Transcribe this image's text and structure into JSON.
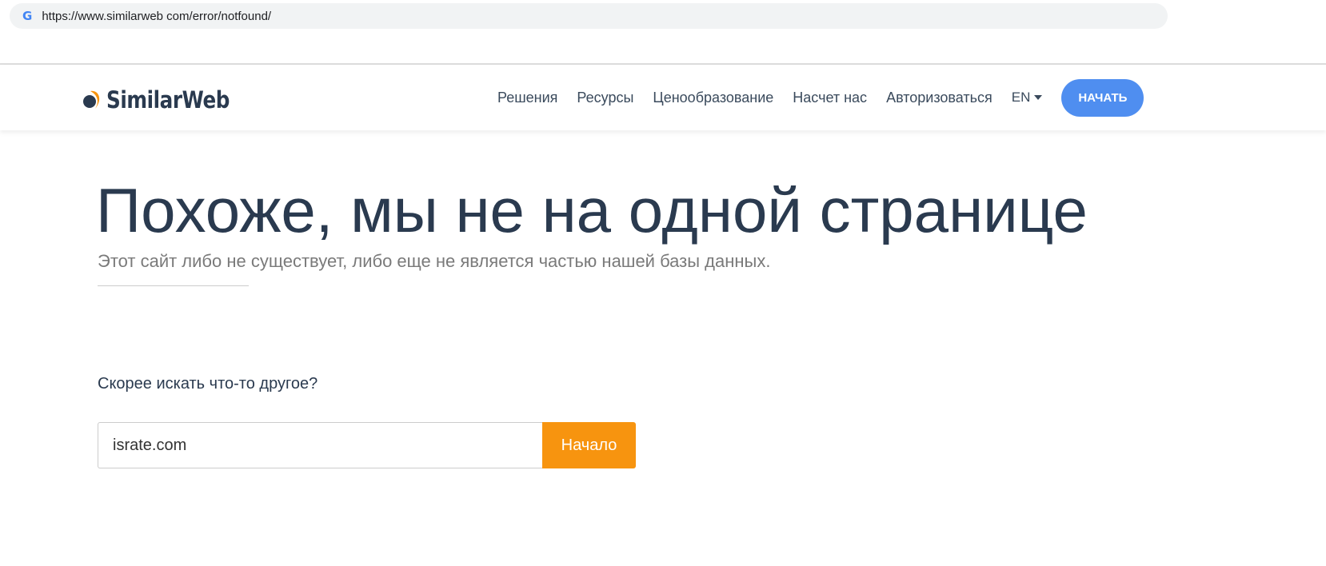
{
  "browser": {
    "url": "https://www.similarweb com/error/notfound/"
  },
  "header": {
    "logo": "SimilarWeb",
    "nav": [
      "Решения",
      "Ресурсы",
      "Ценообразование",
      "Насчет нас",
      "Авторизоваться"
    ],
    "lang": "EN",
    "start": "НАЧАТЬ"
  },
  "main": {
    "title": "Похоже, мы не на одной странице",
    "subtitle": "Этот сайт либо не существует, либо еще не является частью нашей базы данных.",
    "question": "Скорее искать что-то другое?",
    "search_value": "israte.com",
    "search_button": "Начало"
  },
  "colors": {
    "accent": "#4f8ef0",
    "orange": "#f7940f",
    "text": "#2a3a4f"
  }
}
